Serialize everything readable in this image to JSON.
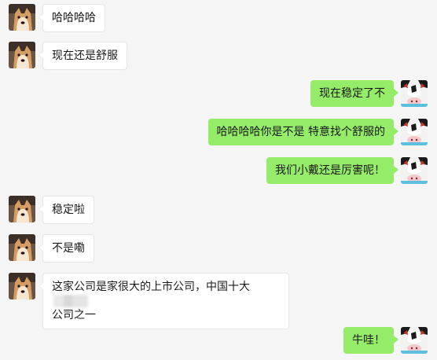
{
  "messages": [
    {
      "side": "left",
      "text": "哈哈哈哈"
    },
    {
      "side": "left",
      "text": "现在还是舒服"
    },
    {
      "side": "right",
      "text": "现在稳定了不"
    },
    {
      "side": "right",
      "text": "哈哈哈哈你是不是 特意找个舒服的"
    },
    {
      "side": "right",
      "text": "我们小戴还是厉害呢！"
    },
    {
      "side": "left",
      "text": "稳定啦"
    },
    {
      "side": "left",
      "text": "不是嘞"
    },
    {
      "side": "left",
      "text_line1": "这家公司是家很大的上市公司，中国十大",
      "text_line2": "公司之一"
    },
    {
      "side": "right",
      "text": "牛哇！"
    }
  ],
  "avatars": {
    "left": "shiba-dog-avatar",
    "right": "cow-avatar"
  },
  "colors": {
    "background": "#f5f5f5",
    "incoming_bubble": "#ffffff",
    "outgoing_bubble": "#95ec69"
  }
}
